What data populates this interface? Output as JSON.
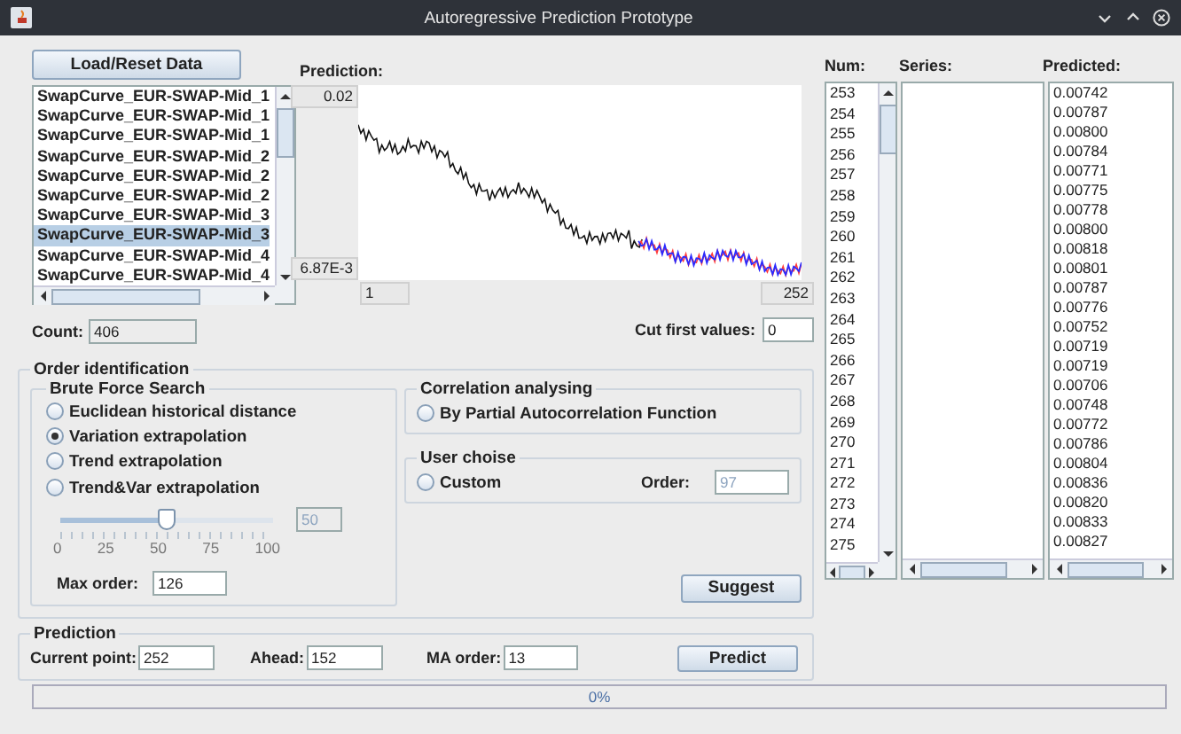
{
  "window": {
    "title": "Autoregressive Prediction Prototype"
  },
  "load_button": "Load/Reset Data",
  "series_list": [
    {
      "label": "SwapCurve_EUR-SWAP-Mid_1",
      "selected": false
    },
    {
      "label": "SwapCurve_EUR-SWAP-Mid_1",
      "selected": false
    },
    {
      "label": "SwapCurve_EUR-SWAP-Mid_1",
      "selected": false
    },
    {
      "label": "SwapCurve_EUR-SWAP-Mid_2",
      "selected": false
    },
    {
      "label": "SwapCurve_EUR-SWAP-Mid_2",
      "selected": false
    },
    {
      "label": "SwapCurve_EUR-SWAP-Mid_2",
      "selected": false
    },
    {
      "label": "SwapCurve_EUR-SWAP-Mid_3",
      "selected": false
    },
    {
      "label": "SwapCurve_EUR-SWAP-Mid_3",
      "selected": true
    },
    {
      "label": "SwapCurve_EUR-SWAP-Mid_4",
      "selected": false
    },
    {
      "label": "SwapCurve_EUR-SWAP-Mid_4",
      "selected": false
    }
  ],
  "count": {
    "label": "Count:",
    "value": "406"
  },
  "prediction_chart": {
    "title": "Prediction:",
    "y_max": "0.02",
    "y_min": "6.87E-3",
    "x_min": "1",
    "x_max": "252"
  },
  "cut_first": {
    "label": "Cut first values:",
    "value": "0"
  },
  "order_identification": {
    "title": "Order identification",
    "brute_force": {
      "title": "Brute Force Search",
      "options": [
        {
          "label": "Euclidean historical distance",
          "selected": false
        },
        {
          "label": "Variation extrapolation",
          "selected": true
        },
        {
          "label": "Trend extrapolation",
          "selected": false
        },
        {
          "label": "Trend&Var extrapolation",
          "selected": false
        }
      ],
      "slider": {
        "level": 0.5,
        "reading": "50",
        "ticks": [
          "0",
          "25",
          "50",
          "75",
          "100"
        ]
      },
      "max_order": {
        "label": "Max order:",
        "value": "126"
      }
    },
    "correlation": {
      "title": "Correlation analysing",
      "option": {
        "label": "By Partial Autocorrelation Function",
        "selected": false
      }
    },
    "user_choice": {
      "title": "User choise",
      "option": {
        "label": "Custom",
        "selected": false
      },
      "order_label": "Order:",
      "order_value": "97"
    },
    "suggest_button": "Suggest"
  },
  "prediction": {
    "title": "Prediction",
    "current_point": {
      "label": "Current point:",
      "value": "252"
    },
    "ahead": {
      "label": "Ahead:",
      "value": "152"
    },
    "ma_order": {
      "label": "MA order:",
      "value": "13"
    },
    "predict_button": "Predict"
  },
  "results": {
    "columns": [
      "Num:",
      "Series:",
      "Predicted:"
    ],
    "num": [
      "253",
      "254",
      "255",
      "256",
      "257",
      "258",
      "259",
      "260",
      "261",
      "262",
      "263",
      "264",
      "265",
      "266",
      "267",
      "268",
      "269",
      "270",
      "271",
      "272",
      "273",
      "274",
      "275"
    ],
    "predicted": [
      "0.00742",
      "0.00787",
      "0.00800",
      "0.00784",
      "0.00771",
      "0.00775",
      "0.00778",
      "0.00800",
      "0.00818",
      "0.00801",
      "0.00787",
      "0.00776",
      "0.00752",
      "0.00719",
      "0.00719",
      "0.00706",
      "0.00748",
      "0.00772",
      "0.00786",
      "0.00804",
      "0.00836",
      "0.00820",
      "0.00833",
      "0.00827"
    ]
  },
  "progress": {
    "level": 0,
    "reading": "0%"
  }
}
